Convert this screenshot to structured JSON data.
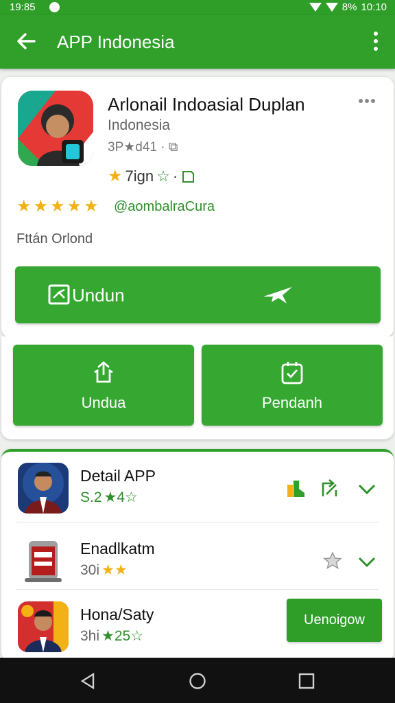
{
  "status": {
    "time": "19:85",
    "battery": "8%",
    "clock": "10:10"
  },
  "header": {
    "title": "APP Indonesia",
    "back_icon": "arrow-left-icon",
    "menu_icon": "more-vertical-icon"
  },
  "app": {
    "name": "Arlonail Indoasial Duplan",
    "developer": "Indonesia",
    "meta": "3P★d41 · ⧉",
    "rating_text": "7ign",
    "handle": "@aombalraCura",
    "subtitle": "Fttán Orlond",
    "stars": 5
  },
  "buttons": {
    "download": "Undun",
    "unduh": "Undua",
    "pendah": "Pendanh"
  },
  "list": [
    {
      "name": "Detail APP",
      "score": "S.2",
      "rating": "★4☆"
    },
    {
      "name": "Enadlkatm",
      "score": "30i",
      "rating": "★★"
    },
    {
      "name": "Hona/Saty",
      "score": "3hi",
      "rating": "★25☆",
      "button": "Uenoigow"
    }
  ],
  "colors": {
    "accent": "#30a02a",
    "star": "#f2b215"
  }
}
